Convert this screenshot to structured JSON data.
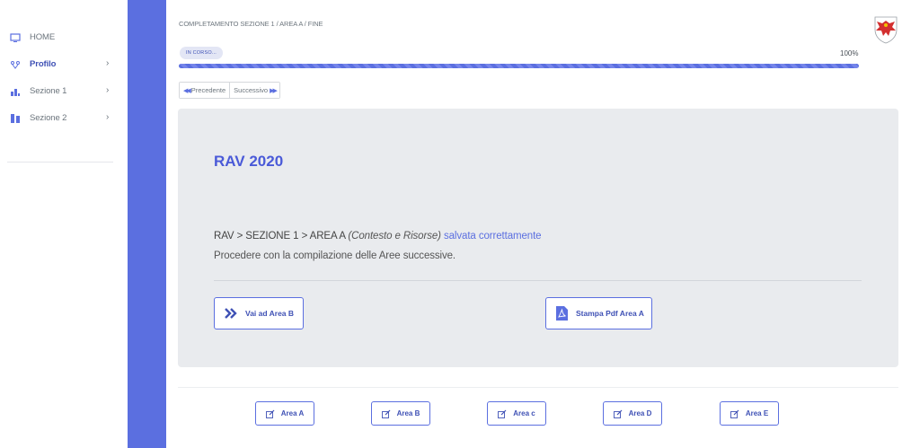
{
  "sidebar": {
    "items": [
      {
        "label": "HOME",
        "icon": "monitor-icon"
      },
      {
        "label": "Profilo",
        "icon": "user-network-icon",
        "active": true
      },
      {
        "label": "Sezione 1",
        "icon": "chart-icon"
      },
      {
        "label": "Sezione 2",
        "icon": "building-icon"
      }
    ]
  },
  "header": {
    "breadcrumb": "COMPLETAMENTO SEZIONE 1 / AREA A / FINE",
    "logo": "coat-of-arms-eagle"
  },
  "progress": {
    "status": "IN CORSO...",
    "percent_label": "100%",
    "value": 1.0
  },
  "pager": {
    "prev_label": "Precedente",
    "next_label": "Successivo"
  },
  "card": {
    "title": "RAV 2020",
    "message_path": "RAV > SEZIONE 1 > AREA A ",
    "message_context": "(Contesto e Risorse)",
    "message_status": " salvata correttamente",
    "message_line2": "Procedere con la compilazione delle Aree successive.",
    "next_button": "Vai ad Area B",
    "pdf_button": "Stampa Pdf Area A"
  },
  "areas": [
    {
      "label": "Area A"
    },
    {
      "label": "Area B"
    },
    {
      "label": "Area c"
    },
    {
      "label": "Area D"
    },
    {
      "label": "Area E"
    }
  ],
  "colors": {
    "accent": "#5b6fe0",
    "accent_dark": "#3f51b5",
    "card_bg": "#e9ebee"
  }
}
